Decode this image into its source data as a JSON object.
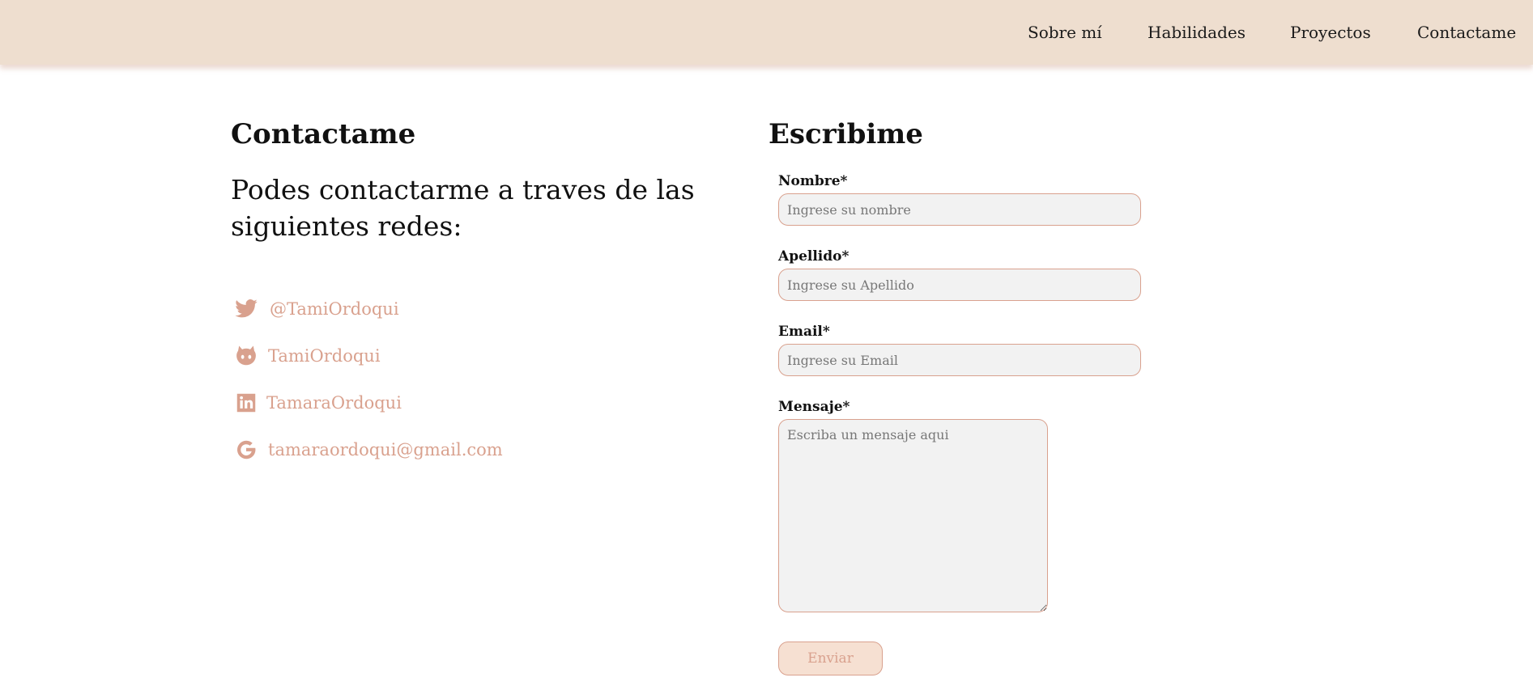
{
  "nav": {
    "items": [
      {
        "label": "Sobre mí"
      },
      {
        "label": "Habilidades"
      },
      {
        "label": "Proyectos"
      },
      {
        "label": "Contactame"
      }
    ]
  },
  "contact": {
    "title": "Contactame",
    "intro": "Podes contactarme a traves de las siguientes redes:",
    "links": [
      {
        "icon": "twitter-icon",
        "label": "@TamiOrdoqui"
      },
      {
        "icon": "github-icon",
        "label": "TamiOrdoqui"
      },
      {
        "icon": "linkedin-icon",
        "label": "TamaraOrdoqui"
      },
      {
        "icon": "google-icon",
        "label": "tamaraordoqui@gmail.com"
      }
    ]
  },
  "form": {
    "title": "Escribime",
    "nombre": {
      "label": "Nombre*",
      "placeholder": "Ingrese su nombre",
      "value": ""
    },
    "apellido": {
      "label": "Apellido*",
      "placeholder": "Ingrese su Apellido",
      "value": ""
    },
    "email": {
      "label": "Email*",
      "placeholder": "Ingrese su Email",
      "value": ""
    },
    "mensaje": {
      "label": "Mensaje*",
      "placeholder": "Escriba un mensaje aqui",
      "value": ""
    },
    "submit_label": "Enviar"
  },
  "colors": {
    "navbar_bg": "#eedecf",
    "accent": "#d9a18e",
    "input_bg": "#f2f2f2",
    "button_bg": "#f6e0d2"
  }
}
